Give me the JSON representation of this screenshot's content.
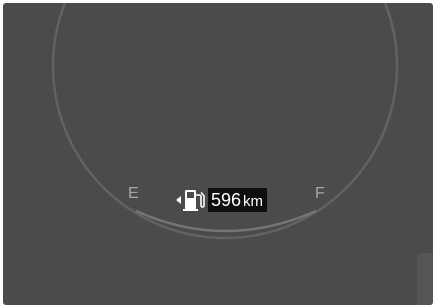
{
  "gauge": {
    "empty_label": "E",
    "full_label": "F"
  },
  "fuel": {
    "icon": "fuel-pump-icon",
    "side_indicator": "left-arrow-icon",
    "range_value": "596",
    "range_unit": "km"
  },
  "colors": {
    "panel_background": "#4b4b4b",
    "dial_ring": "#626262",
    "label_text": "#a9a9a9",
    "readout_background": "#0e0e0e",
    "readout_text": "#ffffff"
  }
}
